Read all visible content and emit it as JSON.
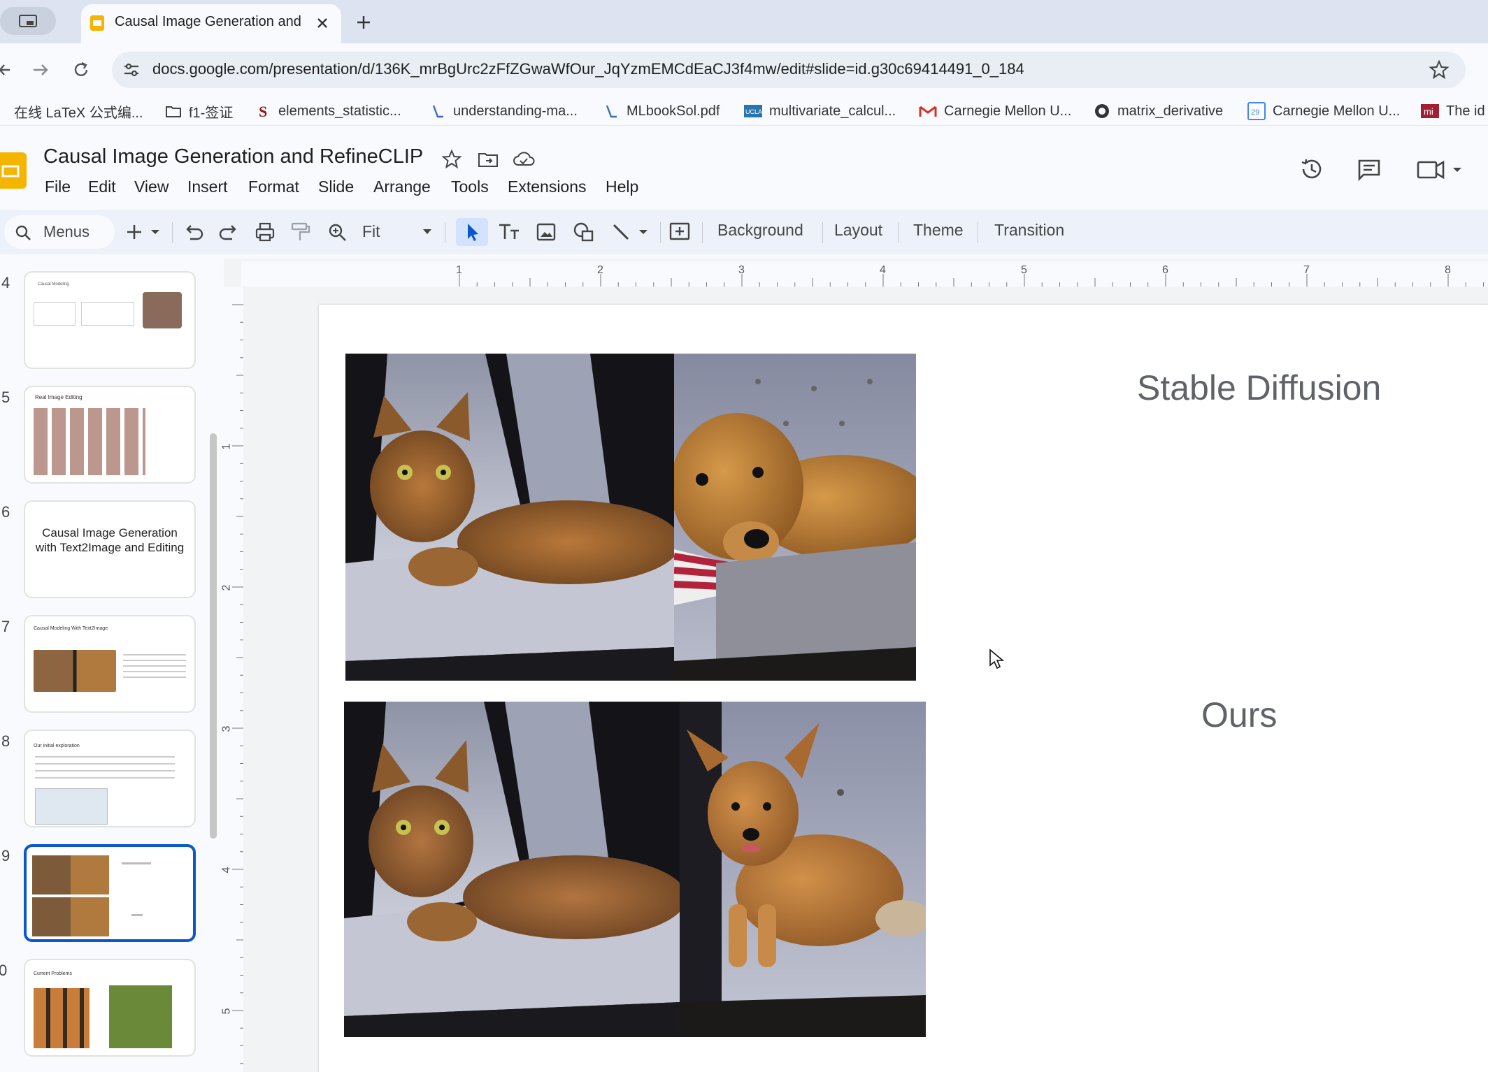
{
  "browser": {
    "tab_title": "Causal Image Generation and",
    "url": "docs.google.com/presentation/d/136K_mrBgUrc2zFfZGwaWfOur_JqYzmEMCdEaCJ3f4mw/edit#slide=id.g30c69414491_0_184",
    "bookmarks": [
      {
        "label": "在线 LaTeX 公式编...",
        "icon": "latex-icon"
      },
      {
        "label": "f1-签证",
        "icon": "folder-icon"
      },
      {
        "label": "elements_statistic...",
        "icon": "stanford-icon"
      },
      {
        "label": "understanding-ma...",
        "icon": "pdf-icon"
      },
      {
        "label": "MLbookSol.pdf",
        "icon": "pdf-icon"
      },
      {
        "label": "multivariate_calcul...",
        "icon": "ucla-icon"
      },
      {
        "label": "Carnegie Mellon U...",
        "icon": "gmail-icon"
      },
      {
        "label": "matrix_derivative",
        "icon": "github-icon"
      },
      {
        "label": "Carnegie Mellon U...",
        "icon": "calendar-icon"
      },
      {
        "label": "The id",
        "icon": "mi-icon"
      }
    ]
  },
  "doc": {
    "title": "Causal Image Generation and RefineCLIP",
    "menus": [
      "File",
      "Edit",
      "View",
      "Insert",
      "Format",
      "Slide",
      "Arrange",
      "Tools",
      "Extensions",
      "Help"
    ]
  },
  "toolbar": {
    "search_label": "Menus",
    "zoom": "Fit",
    "background": "Background",
    "layout": "Layout",
    "theme": "Theme",
    "transition": "Transition"
  },
  "filmstrip": {
    "slides": [
      {
        "num": "4",
        "title": "Causal Modeling"
      },
      {
        "num": "5",
        "title": "Real Image Editing"
      },
      {
        "num": "6",
        "title": "Causal Image Generation with Text2Image and Editing"
      },
      {
        "num": "7",
        "title": "Causal Modeling With Text2Image"
      },
      {
        "num": "8",
        "title": "Our initial exploration"
      },
      {
        "num": "9",
        "title": ""
      },
      {
        "num": "0",
        "title": "Current Problems"
      }
    ],
    "selected": "9"
  },
  "ruler": {
    "h_marks": [
      "1",
      "2",
      "3",
      "4",
      "5",
      "6",
      "7",
      "8"
    ],
    "v_marks": [
      "1",
      "2",
      "3",
      "4",
      "5"
    ]
  },
  "slide": {
    "label_top": "Stable Diffusion",
    "label_bottom": "Ours"
  },
  "colors": {
    "accent": "#0b57d0",
    "slides_yellow": "#f4b400"
  }
}
